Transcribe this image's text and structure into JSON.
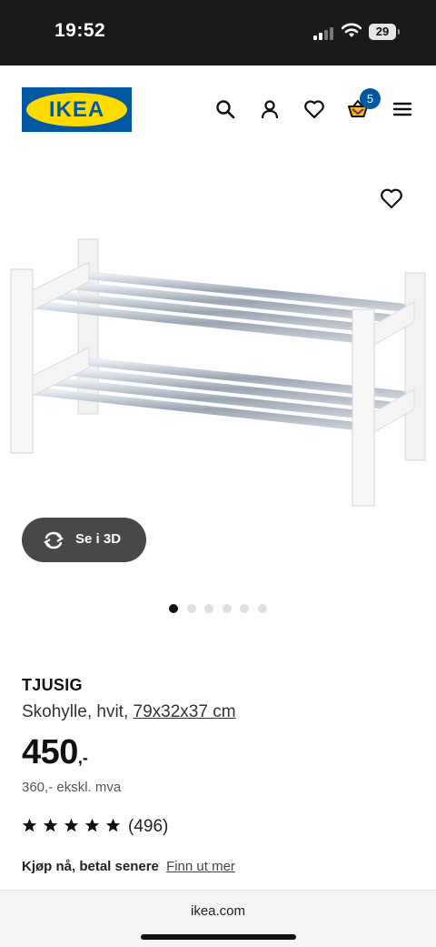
{
  "status_bar": {
    "time": "19:52",
    "battery": "29"
  },
  "header": {
    "logo_text": "IKEA",
    "cart_count": "5",
    "icons": [
      "search-icon",
      "user-icon",
      "heart-icon",
      "cart-icon",
      "menu-icon"
    ]
  },
  "gallery": {
    "view_3d_label": "Se i 3D",
    "total_images": 6,
    "active_image": 1
  },
  "product": {
    "name": "TJUSIG",
    "description": "Skohylle, hvit,",
    "dimensions": "79x32x37 cm",
    "price": "450",
    "price_suffix": ",-",
    "price_ex_vat": "360,- ekskl. mva",
    "rating": 5,
    "review_count": "(496)"
  },
  "klarna": {
    "text": "Kjøp nå, betal senere",
    "link": "Finn ut mer"
  },
  "browser": {
    "url": "ikea.com"
  },
  "colors": {
    "ikea_blue": "#0058a3",
    "ikea_yellow": "#ffdb00",
    "button_dark": "#484848"
  }
}
